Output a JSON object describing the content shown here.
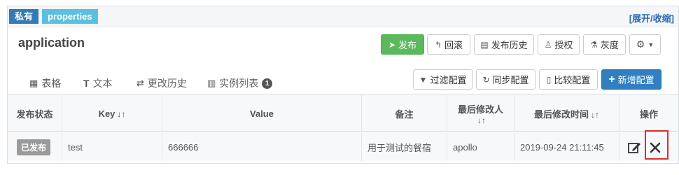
{
  "header": {
    "tag_private": "私有",
    "tag_properties": "properties",
    "expand_toggle": "[展开/收缩]"
  },
  "namespace": {
    "title": "application"
  },
  "toolbar": {
    "publish": "发布",
    "rollback": "回滚",
    "publish_history": "发布历史",
    "authorize": "授权",
    "gray": "灰度"
  },
  "tabs": [
    {
      "label": "表格"
    },
    {
      "label": "文本"
    },
    {
      "label": "更改历史"
    },
    {
      "label": "实例列表",
      "badge": "1"
    }
  ],
  "actions": {
    "filter": "过滤配置",
    "sync": "同步配置",
    "compare": "比较配置",
    "add": "新增配置"
  },
  "table": {
    "columns": [
      "发布状态",
      "Key",
      "Value",
      "备注",
      "最后修改人",
      "最后修改时间",
      "操作"
    ],
    "rows": [
      {
        "status": "已发布",
        "key": "test",
        "value": "666666",
        "comment": "用于测试的餐宿",
        "modifier": "apollo",
        "modified_time": "2019-09-24 21:11:45"
      }
    ]
  },
  "colors": {
    "primary": "#337ab7",
    "success": "#5cb85c",
    "info": "#5bc0de",
    "highlight": "#d9302c"
  }
}
